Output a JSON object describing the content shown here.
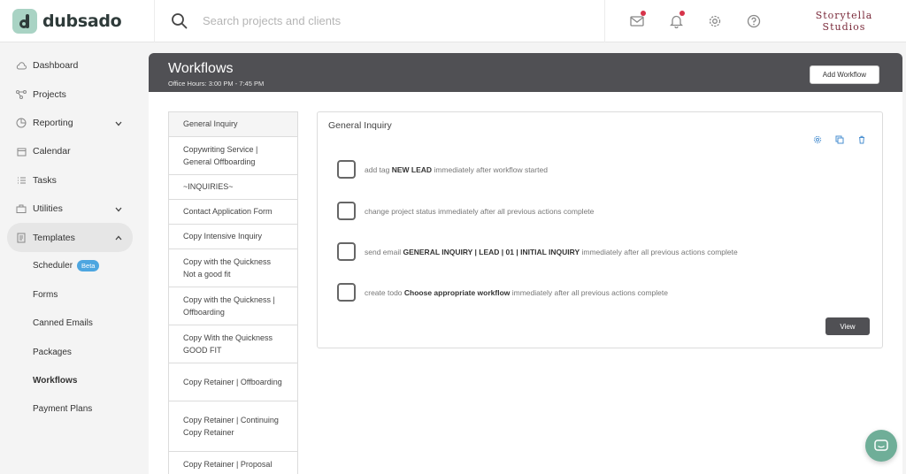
{
  "brand": {
    "logo_text": "dubsado",
    "studio_line1": "Storytella",
    "studio_line2": "Studios"
  },
  "search": {
    "placeholder": "Search projects and clients"
  },
  "sidebar": {
    "items": [
      {
        "label": "Dashboard",
        "icon": "cloud-icon"
      },
      {
        "label": "Projects",
        "icon": "projects-icon"
      },
      {
        "label": "Reporting",
        "icon": "reporting-icon",
        "expandable": true
      },
      {
        "label": "Calendar",
        "icon": "calendar-icon"
      },
      {
        "label": "Tasks",
        "icon": "tasks-icon"
      },
      {
        "label": "Utilities",
        "icon": "utilities-icon",
        "expandable": true
      },
      {
        "label": "Templates",
        "icon": "templates-icon",
        "expanded": true
      }
    ],
    "sub_items": [
      {
        "label": "Scheduler",
        "badge": "Beta"
      },
      {
        "label": "Forms"
      },
      {
        "label": "Canned Emails"
      },
      {
        "label": "Packages"
      },
      {
        "label": "Workflows"
      },
      {
        "label": "Payment Plans"
      }
    ]
  },
  "header": {
    "title": "Workflows",
    "subtitle": "Office Hours: 3:00 PM - 7:45 PM",
    "add_button": "Add Workflow"
  },
  "workflows": [
    "General Inquiry",
    "Copywriting Service | General Offboarding",
    "~INQUIRIES~",
    "Contact Application Form",
    "Copy Intensive Inquiry",
    "Copy with the Quickness Not a good fit",
    "Copy with the Quickness | Offboarding",
    "Copy With the Quickness GOOD FIT",
    "Copy Retainer | Offboarding",
    "Copy Retainer | Continuing Copy Retainer",
    "Copy Retainer | Proposal (Extended BD)"
  ],
  "panel": {
    "title": "General Inquiry",
    "view_button": "View",
    "steps": [
      {
        "pre": "add tag ",
        "bold": "NEW LEAD",
        "post": " immediately after workflow started"
      },
      {
        "pre": "change project status immediately after all previous actions complete",
        "bold": "",
        "post": ""
      },
      {
        "pre": "send email ",
        "bold": "GENERAL INQUIRY | LEAD | 01 | INITIAL INQUIRY",
        "post": " immediately after all previous actions complete"
      },
      {
        "pre": "create todo ",
        "bold": "Choose appropriate workflow",
        "post": " immediately after all previous actions complete"
      }
    ]
  },
  "colors": {
    "header_bg": "#505054",
    "accent_green": "#6fae98",
    "beta_blue": "#4da6e0",
    "notif_red": "#d6334a"
  }
}
